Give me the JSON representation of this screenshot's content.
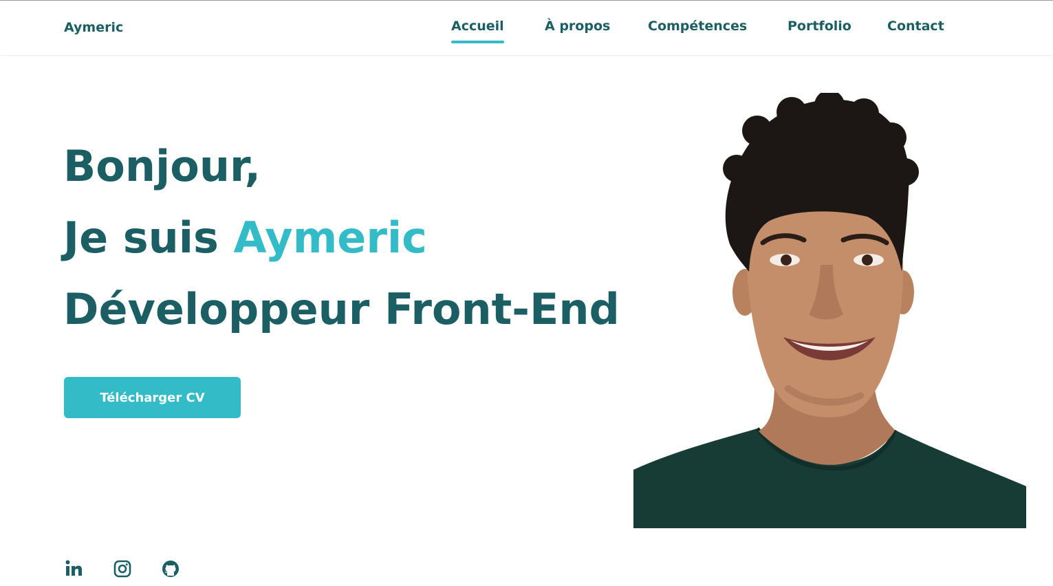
{
  "header": {
    "logo": "Aymeric",
    "nav": [
      {
        "label": "Accueil",
        "active": true
      },
      {
        "label": "À propos",
        "active": false
      },
      {
        "label": "Compétences",
        "active": false
      },
      {
        "label": "Portfolio",
        "active": false
      },
      {
        "label": "Contact",
        "active": false
      }
    ]
  },
  "hero": {
    "line1": "Bonjour,",
    "line2_prefix": "Je suis ",
    "line2_name": "Aymeric",
    "line3": "Développeur Front-End",
    "cv_button": "Télécharger CV"
  },
  "socials": [
    {
      "icon": "linkedin-icon"
    },
    {
      "icon": "instagram-icon"
    },
    {
      "icon": "github-icon"
    }
  ],
  "colors": {
    "primary": "#1b5e63",
    "accent": "#33bcc8",
    "background": "#ffffff"
  }
}
